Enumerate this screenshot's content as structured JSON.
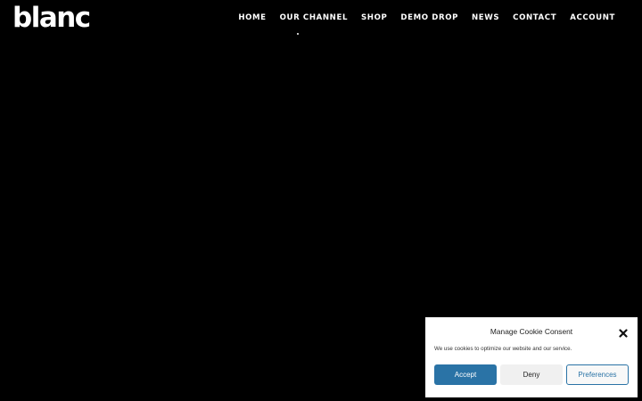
{
  "header": {
    "logo_text": "blanc",
    "nav": [
      {
        "label": "HOME"
      },
      {
        "label": "OUR CHANNEL"
      },
      {
        "label": "SHOP"
      },
      {
        "label": "DEMO DROP"
      },
      {
        "label": "NEWS"
      },
      {
        "label": "CONTACT"
      },
      {
        "label": "ACCOUNT"
      }
    ]
  },
  "cookie_banner": {
    "title": "Manage Cookie Consent",
    "message": "We use cookies to optimize our website and our service.",
    "close_icon": "close-icon",
    "buttons": {
      "accept": "Accept",
      "deny": "Deny",
      "preferences": "Preferences"
    }
  },
  "colors": {
    "background": "#000000",
    "accent": "#2a73a6",
    "text_light": "#ffffff"
  }
}
